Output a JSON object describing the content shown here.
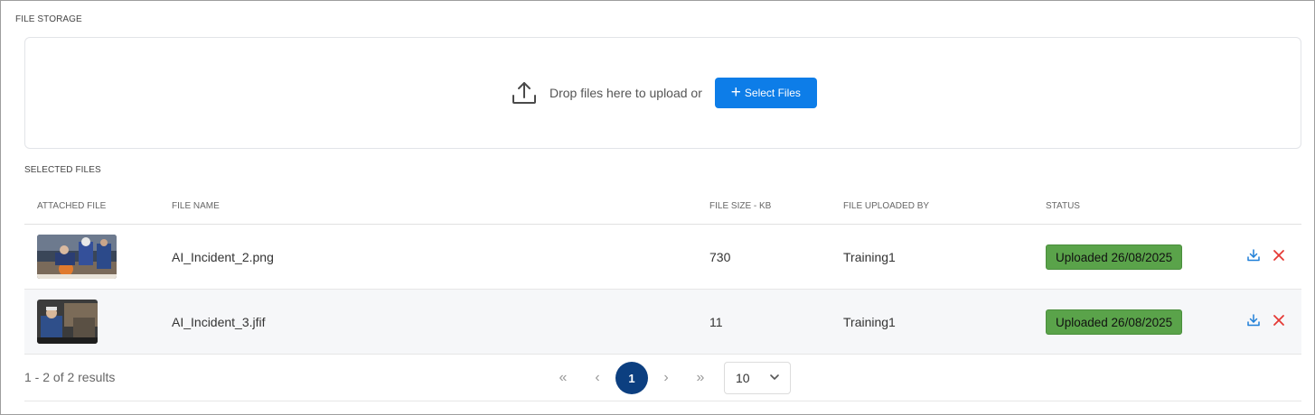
{
  "storage": {
    "title": "FILE STORAGE"
  },
  "dropzone": {
    "text": "Drop files here to upload or",
    "select_label": "Select Files"
  },
  "selected": {
    "title": "SELECTED FILES"
  },
  "table": {
    "headers": [
      "ATTACHED FILE",
      "FILE NAME",
      "FILE SIZE - KB",
      "FILE UPLOADED BY",
      "STATUS"
    ],
    "rows": [
      {
        "file_name": "AI_Incident_2.png",
        "size": "730",
        "uploaded_by": "Training1",
        "status": "Uploaded 26/08/2025"
      },
      {
        "file_name": "AI_Incident_3.jfif",
        "size": "11",
        "uploaded_by": "Training1",
        "status": "Uploaded 26/08/2025"
      }
    ]
  },
  "pagination": {
    "summary": "1 - 2 of 2 results",
    "current_page": "1",
    "page_size": "10"
  },
  "colors": {
    "accent": "#0d7de8",
    "status_green": "#5aa34a",
    "pager_active": "#0c3f80",
    "delete_red": "#e53935"
  },
  "icons": [
    "upload-icon",
    "plus-icon",
    "download-icon",
    "close-icon",
    "first-page-icon",
    "prev-page-icon",
    "next-page-icon",
    "last-page-icon",
    "chevron-down-icon"
  ]
}
